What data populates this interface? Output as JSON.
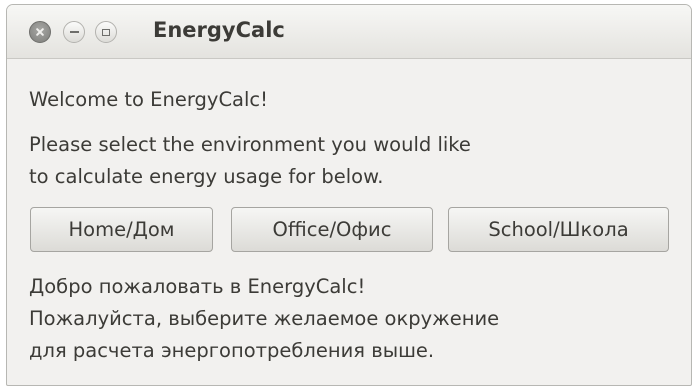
{
  "window": {
    "title": "EnergyCalc"
  },
  "main": {
    "welcome": "Welcome to EnergyCalc!",
    "instructions_line1": "Please select the environment you would like",
    "instructions_line2": "to calculate energy usage for below.",
    "buttons": [
      {
        "label": "Home/Дом"
      },
      {
        "label": "Office/Офис"
      },
      {
        "label": "School/Школа"
      }
    ],
    "russian_line1": "Добро пожаловать в EnergyCalc!",
    "russian_line2": "Пожалуйста, выберите желаемое окружение",
    "russian_line3": "для расчета энергопотребления выше."
  }
}
